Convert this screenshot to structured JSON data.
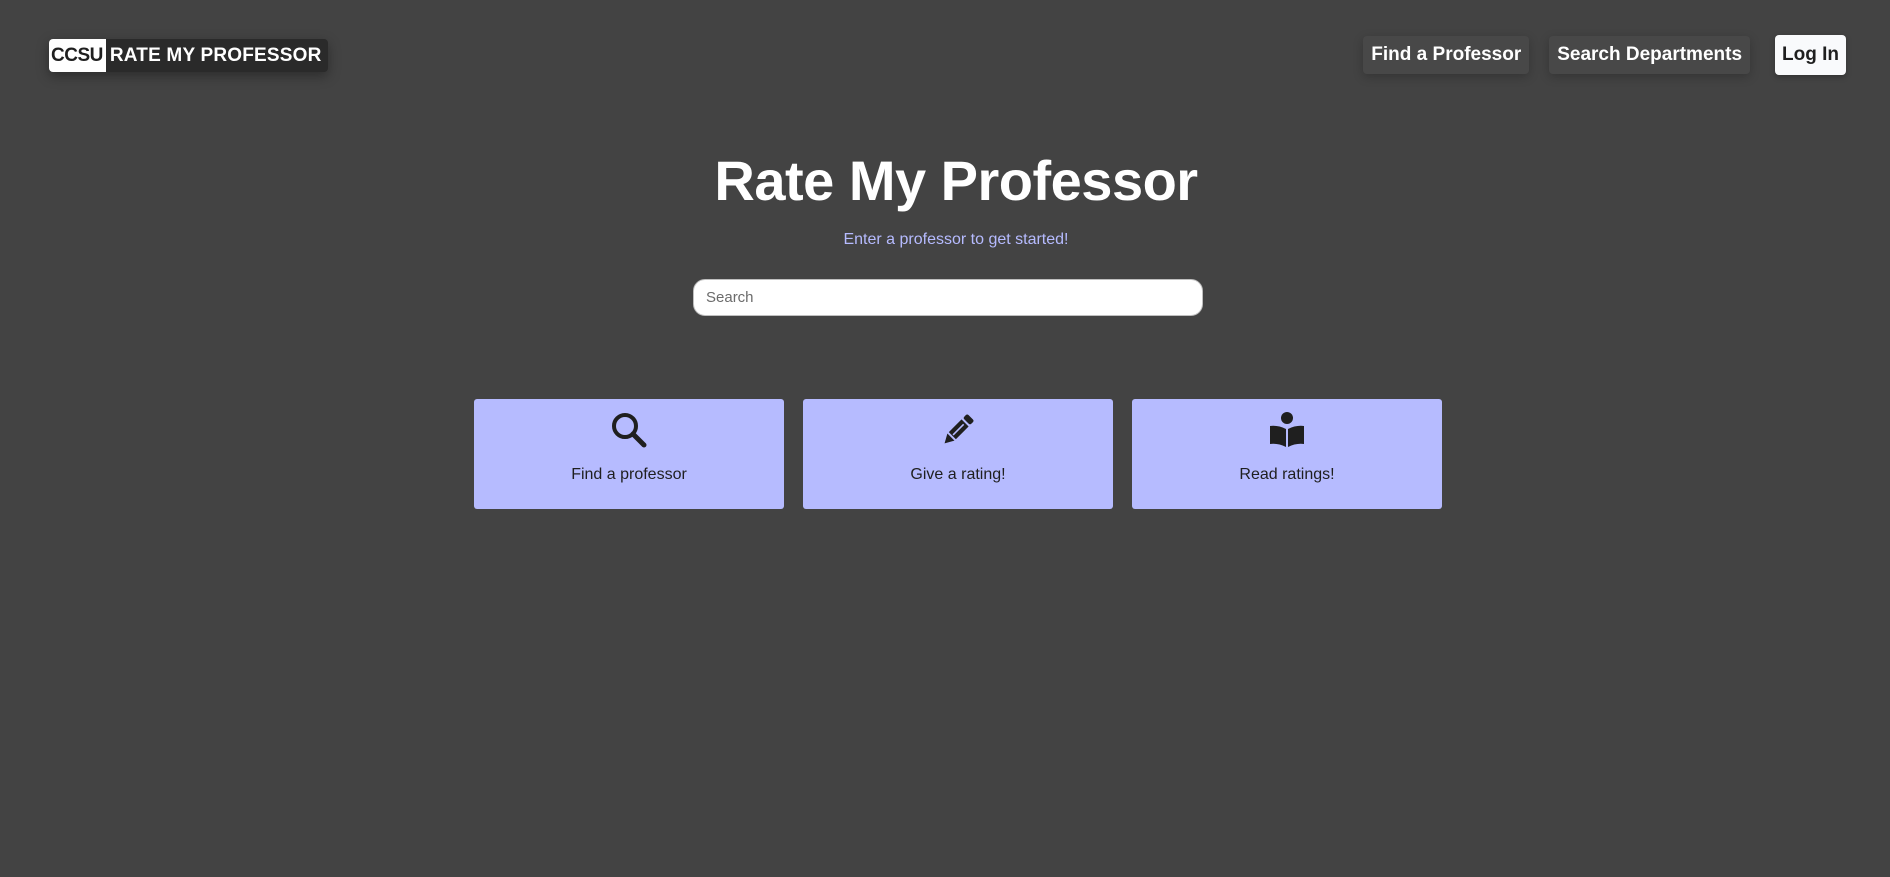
{
  "header": {
    "logo": {
      "mark": "CCSU",
      "text": "RATE MY PROFESSOR"
    },
    "nav": {
      "find_professor": "Find a Professor",
      "search_departments": "Search Departments",
      "login": "Log In"
    }
  },
  "hero": {
    "title": "Rate My Professor",
    "subtitle": "Enter a professor to get started!",
    "search": {
      "placeholder": "Search",
      "value": ""
    }
  },
  "cards": [
    {
      "label": "Find a professor",
      "icon": "search-icon"
    },
    {
      "label": "Give a rating!",
      "icon": "pencil-icon"
    },
    {
      "label": "Read ratings!",
      "icon": "book-reader-icon"
    }
  ],
  "colors": {
    "background": "#434343",
    "accent": "#b6bbff",
    "text_light": "#ffffff",
    "text_dark": "#1f1f1f"
  }
}
